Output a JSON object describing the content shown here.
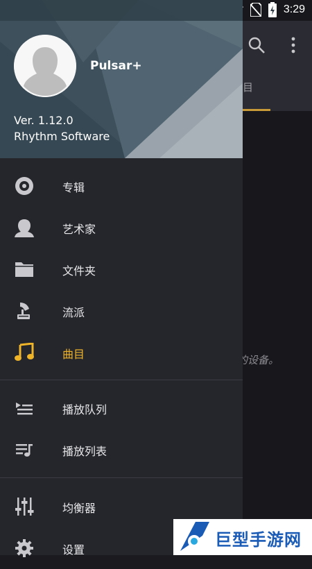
{
  "status_bar": {
    "time": "3:29"
  },
  "background": {
    "tab_label": "目",
    "empty_text": "的设备。"
  },
  "drawer": {
    "app_name": "Pulsar+",
    "version": "Ver. 1.12.0",
    "company": "Rhythm Software",
    "items": [
      {
        "label": "专辑",
        "icon": "album-icon"
      },
      {
        "label": "艺术家",
        "icon": "artist-icon"
      },
      {
        "label": "文件夹",
        "icon": "folder-icon"
      },
      {
        "label": "流派",
        "icon": "genre-icon"
      },
      {
        "label": "曲目",
        "icon": "music-note-icon",
        "active": true
      },
      {
        "label": "播放队列",
        "icon": "queue-icon"
      },
      {
        "label": "播放列表",
        "icon": "playlist-icon"
      },
      {
        "label": "均衡器",
        "icon": "equalizer-icon"
      },
      {
        "label": "设置",
        "icon": "gear-icon"
      }
    ]
  },
  "colors": {
    "accent": "#f0b429",
    "drawer_bg": "#25262c",
    "header_bg": "#465965"
  },
  "watermark": {
    "text": "巨型手游网"
  }
}
